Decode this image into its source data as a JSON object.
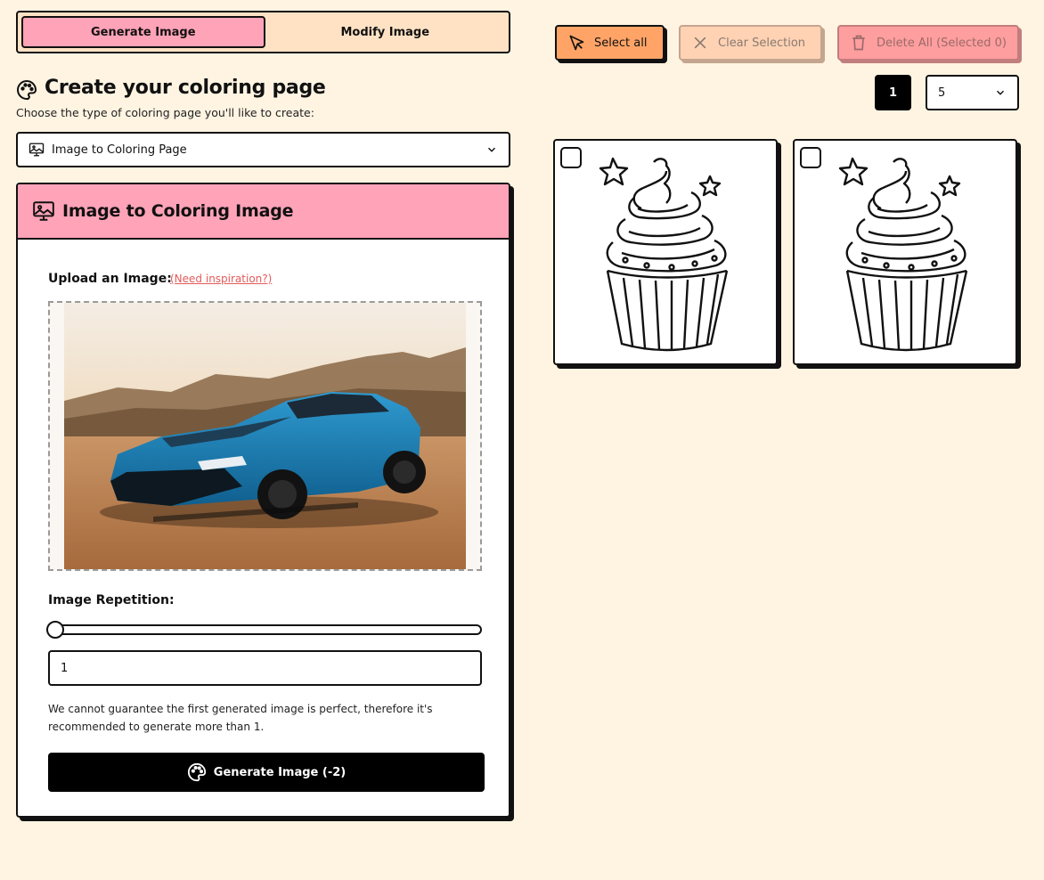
{
  "mode_toggle": {
    "generate_label": "Generate Image",
    "modify_label": "Modify Image"
  },
  "header": {
    "title": "Create your coloring page",
    "subtitle": "Choose the type of coloring page you'll like to create:"
  },
  "type_select": {
    "selected": "Image to Coloring Page"
  },
  "card": {
    "title": "Image to Coloring Image",
    "upload_label": "Upload an Image:",
    "inspiration_link": "(Need inspiration?)",
    "repetition_label": "Image Repetition:",
    "repetition_value": "1",
    "repetition_slider_fraction": 0.0,
    "note": "We cannot guarantee the first generated image is perfect, therefore it's recommended to generate more than 1.",
    "generate_button": "Generate Image (-2)"
  },
  "toolbar": {
    "select_all": "Select all",
    "clear_selection": "Clear Selection",
    "delete_all": "Delete All (Selected 0)"
  },
  "pagination": {
    "current_page": "1",
    "page_size": "5"
  },
  "gallery": {
    "items": [
      {
        "checked": false,
        "icon": "cupcake-coloring-image"
      },
      {
        "checked": false,
        "icon": "cupcake-coloring-image"
      }
    ]
  },
  "colors": {
    "background": "#fff4e2",
    "accent_pink": "#ffa3b8",
    "accent_orange": "#ffa466",
    "link_red": "#e35b5b"
  }
}
